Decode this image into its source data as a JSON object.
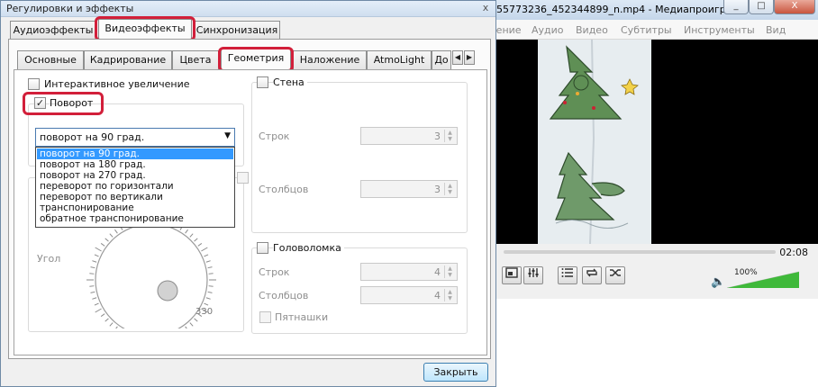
{
  "player": {
    "title": "55773236_452344899_n.mp4 - Медиапроигр...",
    "menu": [
      "Сение",
      "Аудио",
      "Видео",
      "Субтитры",
      "Инструменты",
      "Вид"
    ],
    "time": "02:08",
    "volume_label": "100%",
    "volume_level": 1.0,
    "window_buttons": [
      "_",
      "□",
      "X"
    ],
    "control_icons": [
      "frame-icon",
      "equalizer-icon",
      "playlist-icon",
      "loop-icon",
      "shuffle-icon"
    ]
  },
  "dialog": {
    "title": "Регулировки и эффекты",
    "close_glyph": "x",
    "top_tabs": [
      "Аудиоэффекты",
      "Видеоэффекты",
      "Синхронизация"
    ],
    "inner_tabs": [
      "Основные",
      "Кадрирование",
      "Цвета",
      "Геометрия",
      "Наложение",
      "AtmoLight",
      "До"
    ],
    "interactive_zoom_label": "Интерактивное увеличение",
    "rotate_label": "Поворот",
    "rotate_checked": true,
    "rotate_selected": "поворот на 90 град.",
    "rotate_options": [
      "поворот на 90 град.",
      "поворот на 180 град.",
      "поворот на 270 град.",
      "переворот по горизонтали",
      "переворот по вертикали",
      "транспонирование",
      "обратное транспонирование"
    ],
    "angle_label": "Угол",
    "dial_mark": "330",
    "wall_label": "Стена",
    "wall_rows_label": "Строк",
    "wall_rows_value": "3",
    "wall_cols_label": "Столбцов",
    "wall_cols_value": "3",
    "puzzle_label": "Головоломка",
    "puzzle_rows_label": "Строк",
    "puzzle_rows_value": "4",
    "puzzle_cols_label": "Столбцов",
    "puzzle_cols_value": "4",
    "fifteen_label": "Пятнашки",
    "close_button": "Закрыть",
    "check_glyph": "✓"
  },
  "colors": {
    "highlight_ring": "#d21f3a",
    "selection": "#3399ff",
    "volume_green": "#3fb93a"
  }
}
